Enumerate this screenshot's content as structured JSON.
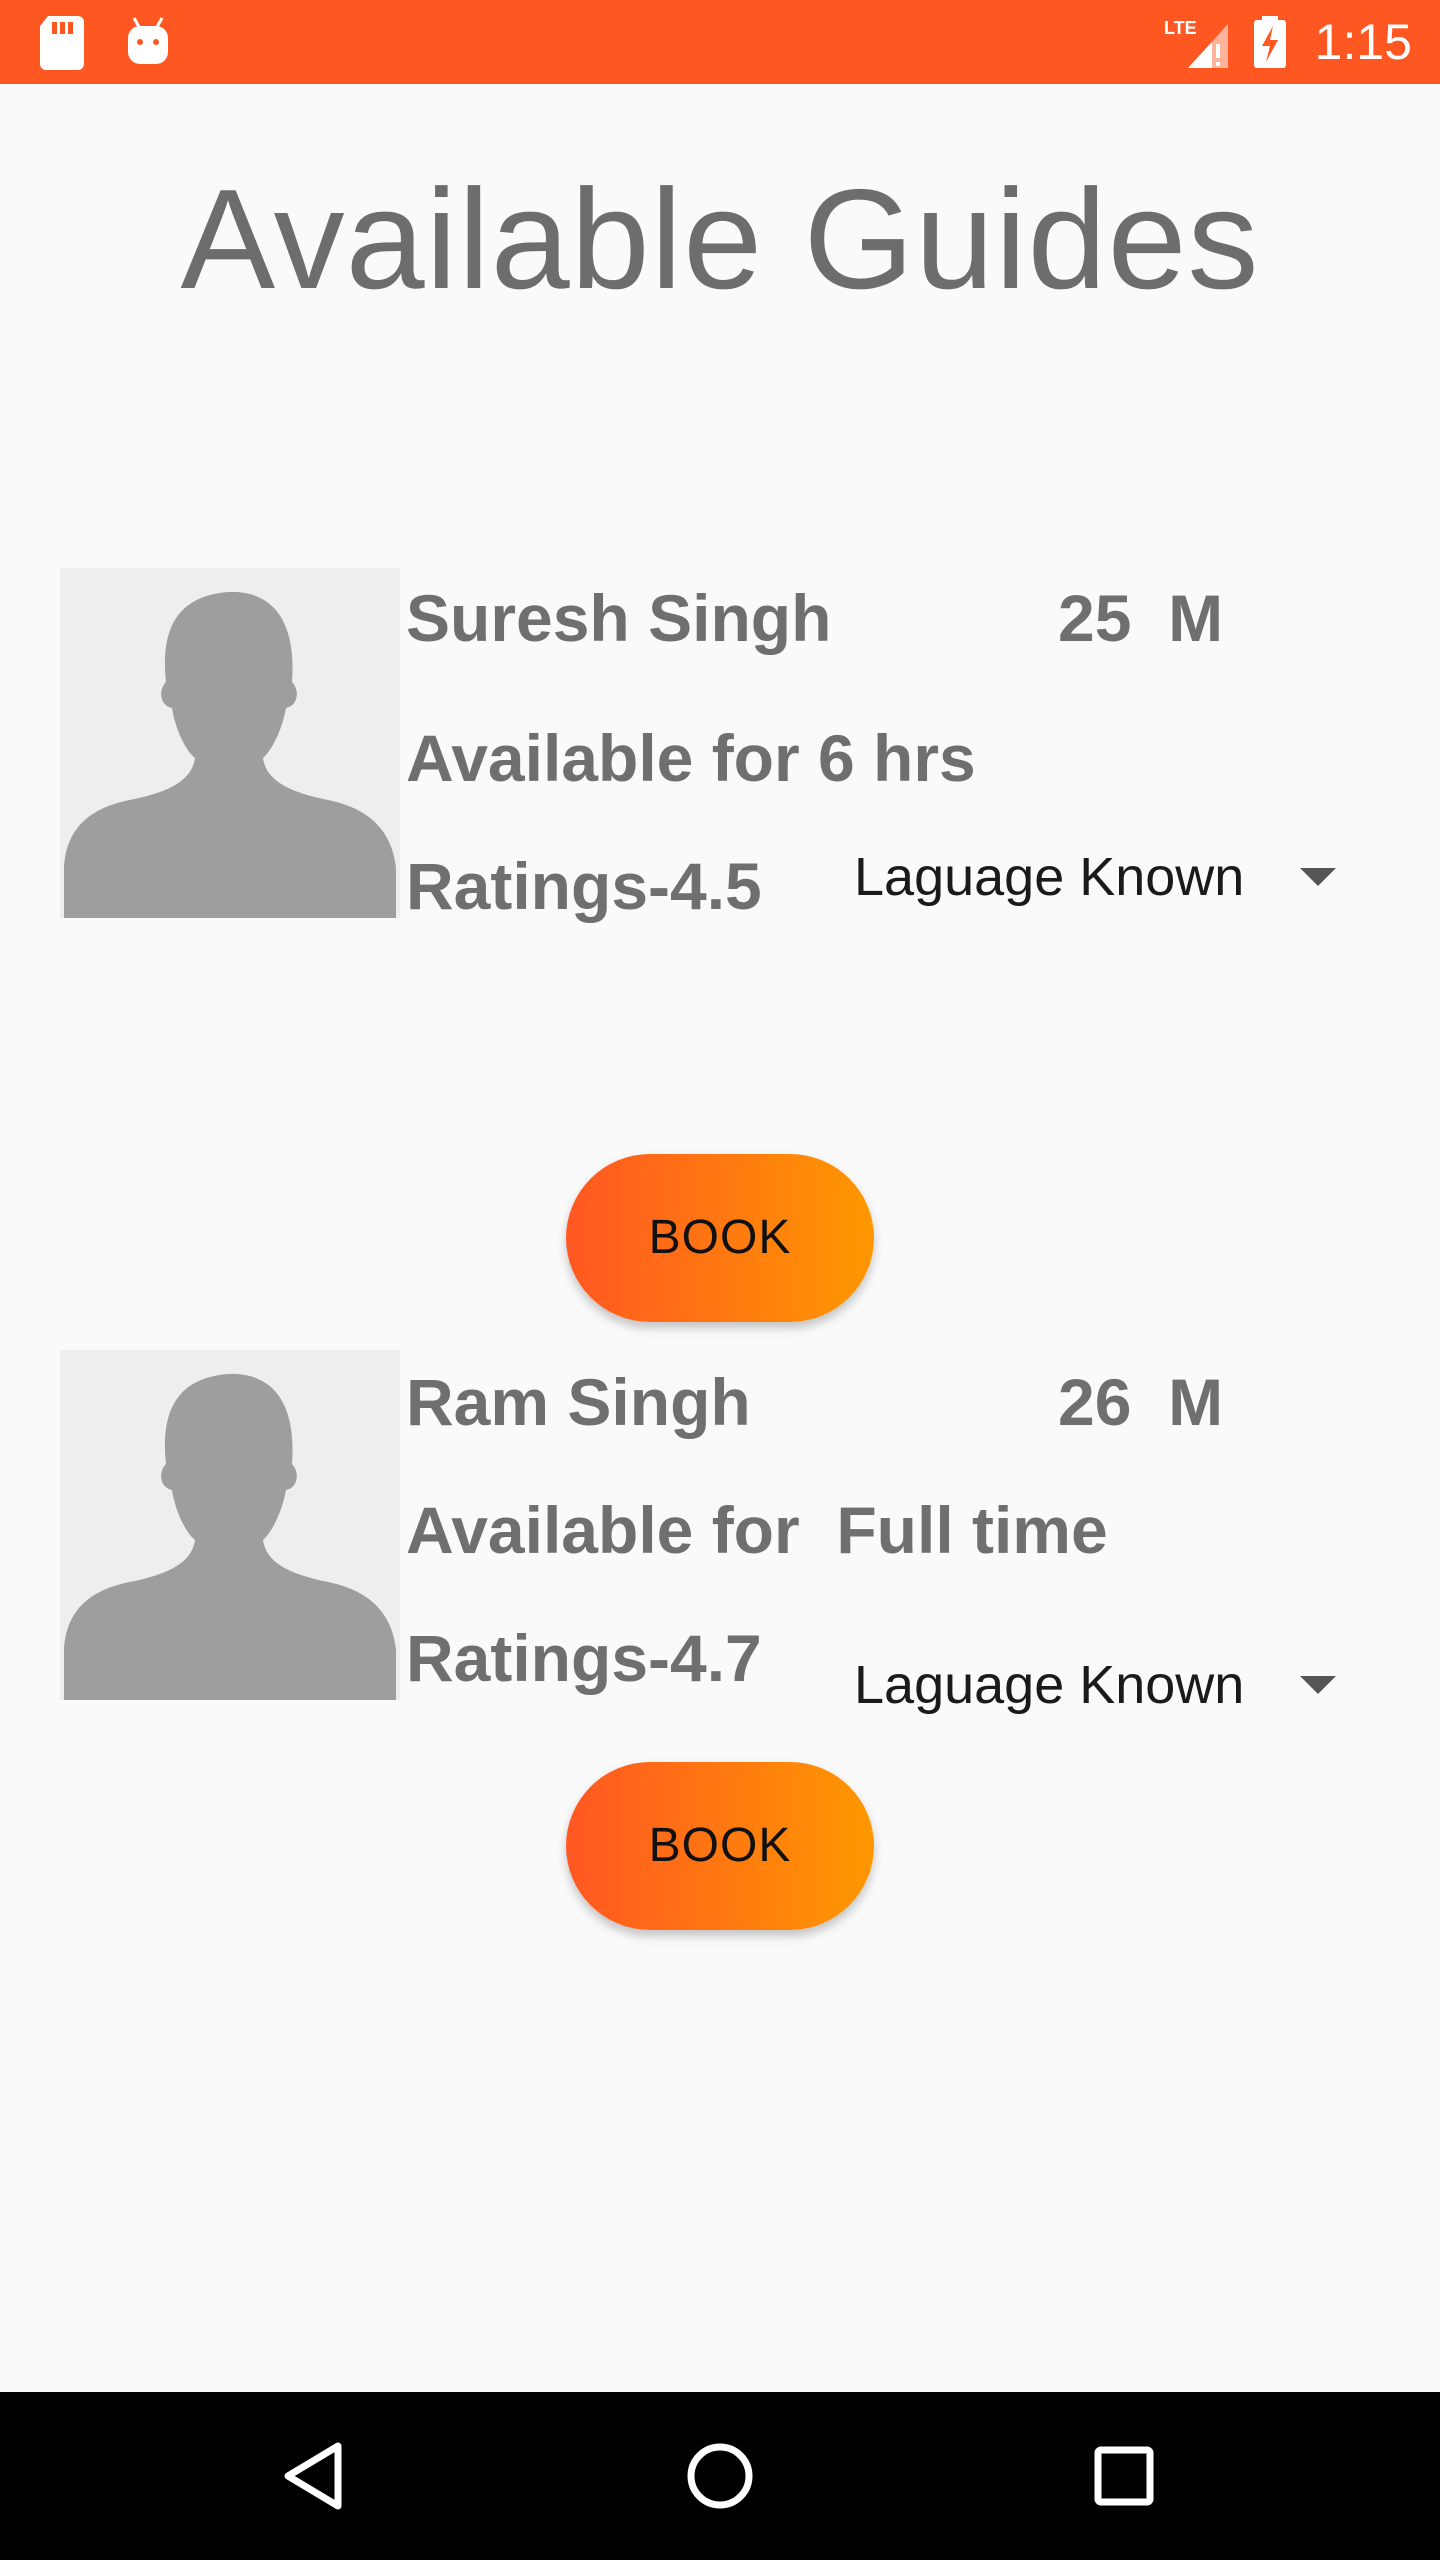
{
  "status_bar": {
    "time": "1:15",
    "network_label": "LTE",
    "icons": [
      "sd-card-icon",
      "android-debug-icon",
      "lte-signal-icon",
      "battery-charging-icon"
    ],
    "background_color": "#ff5722"
  },
  "page": {
    "title": "Available Guides"
  },
  "guides": [
    {
      "name": "Suresh Singh",
      "age_gender": "25  M",
      "availability": "Available for 6 hrs",
      "rating": "Ratings-4.5",
      "language_dropdown": "Laguage Known",
      "book_label": "BOOK",
      "avatar_icon": "person-placeholder-icon"
    },
    {
      "name": "Ram Singh",
      "age_gender": "26  M",
      "availability": "Available for  Full time",
      "rating": "Ratings-4.7",
      "language_dropdown": "Laguage Known",
      "book_label": "BOOK",
      "avatar_icon": "person-placeholder-icon"
    }
  ],
  "nav_bar": {
    "icons": [
      "back-icon",
      "home-icon",
      "recents-icon"
    ]
  },
  "colors": {
    "accent": "#ff5722",
    "button_gradient_start": "#ff5722",
    "button_gradient_end": "#ff9800",
    "text_gray": "#6f6f6f"
  }
}
